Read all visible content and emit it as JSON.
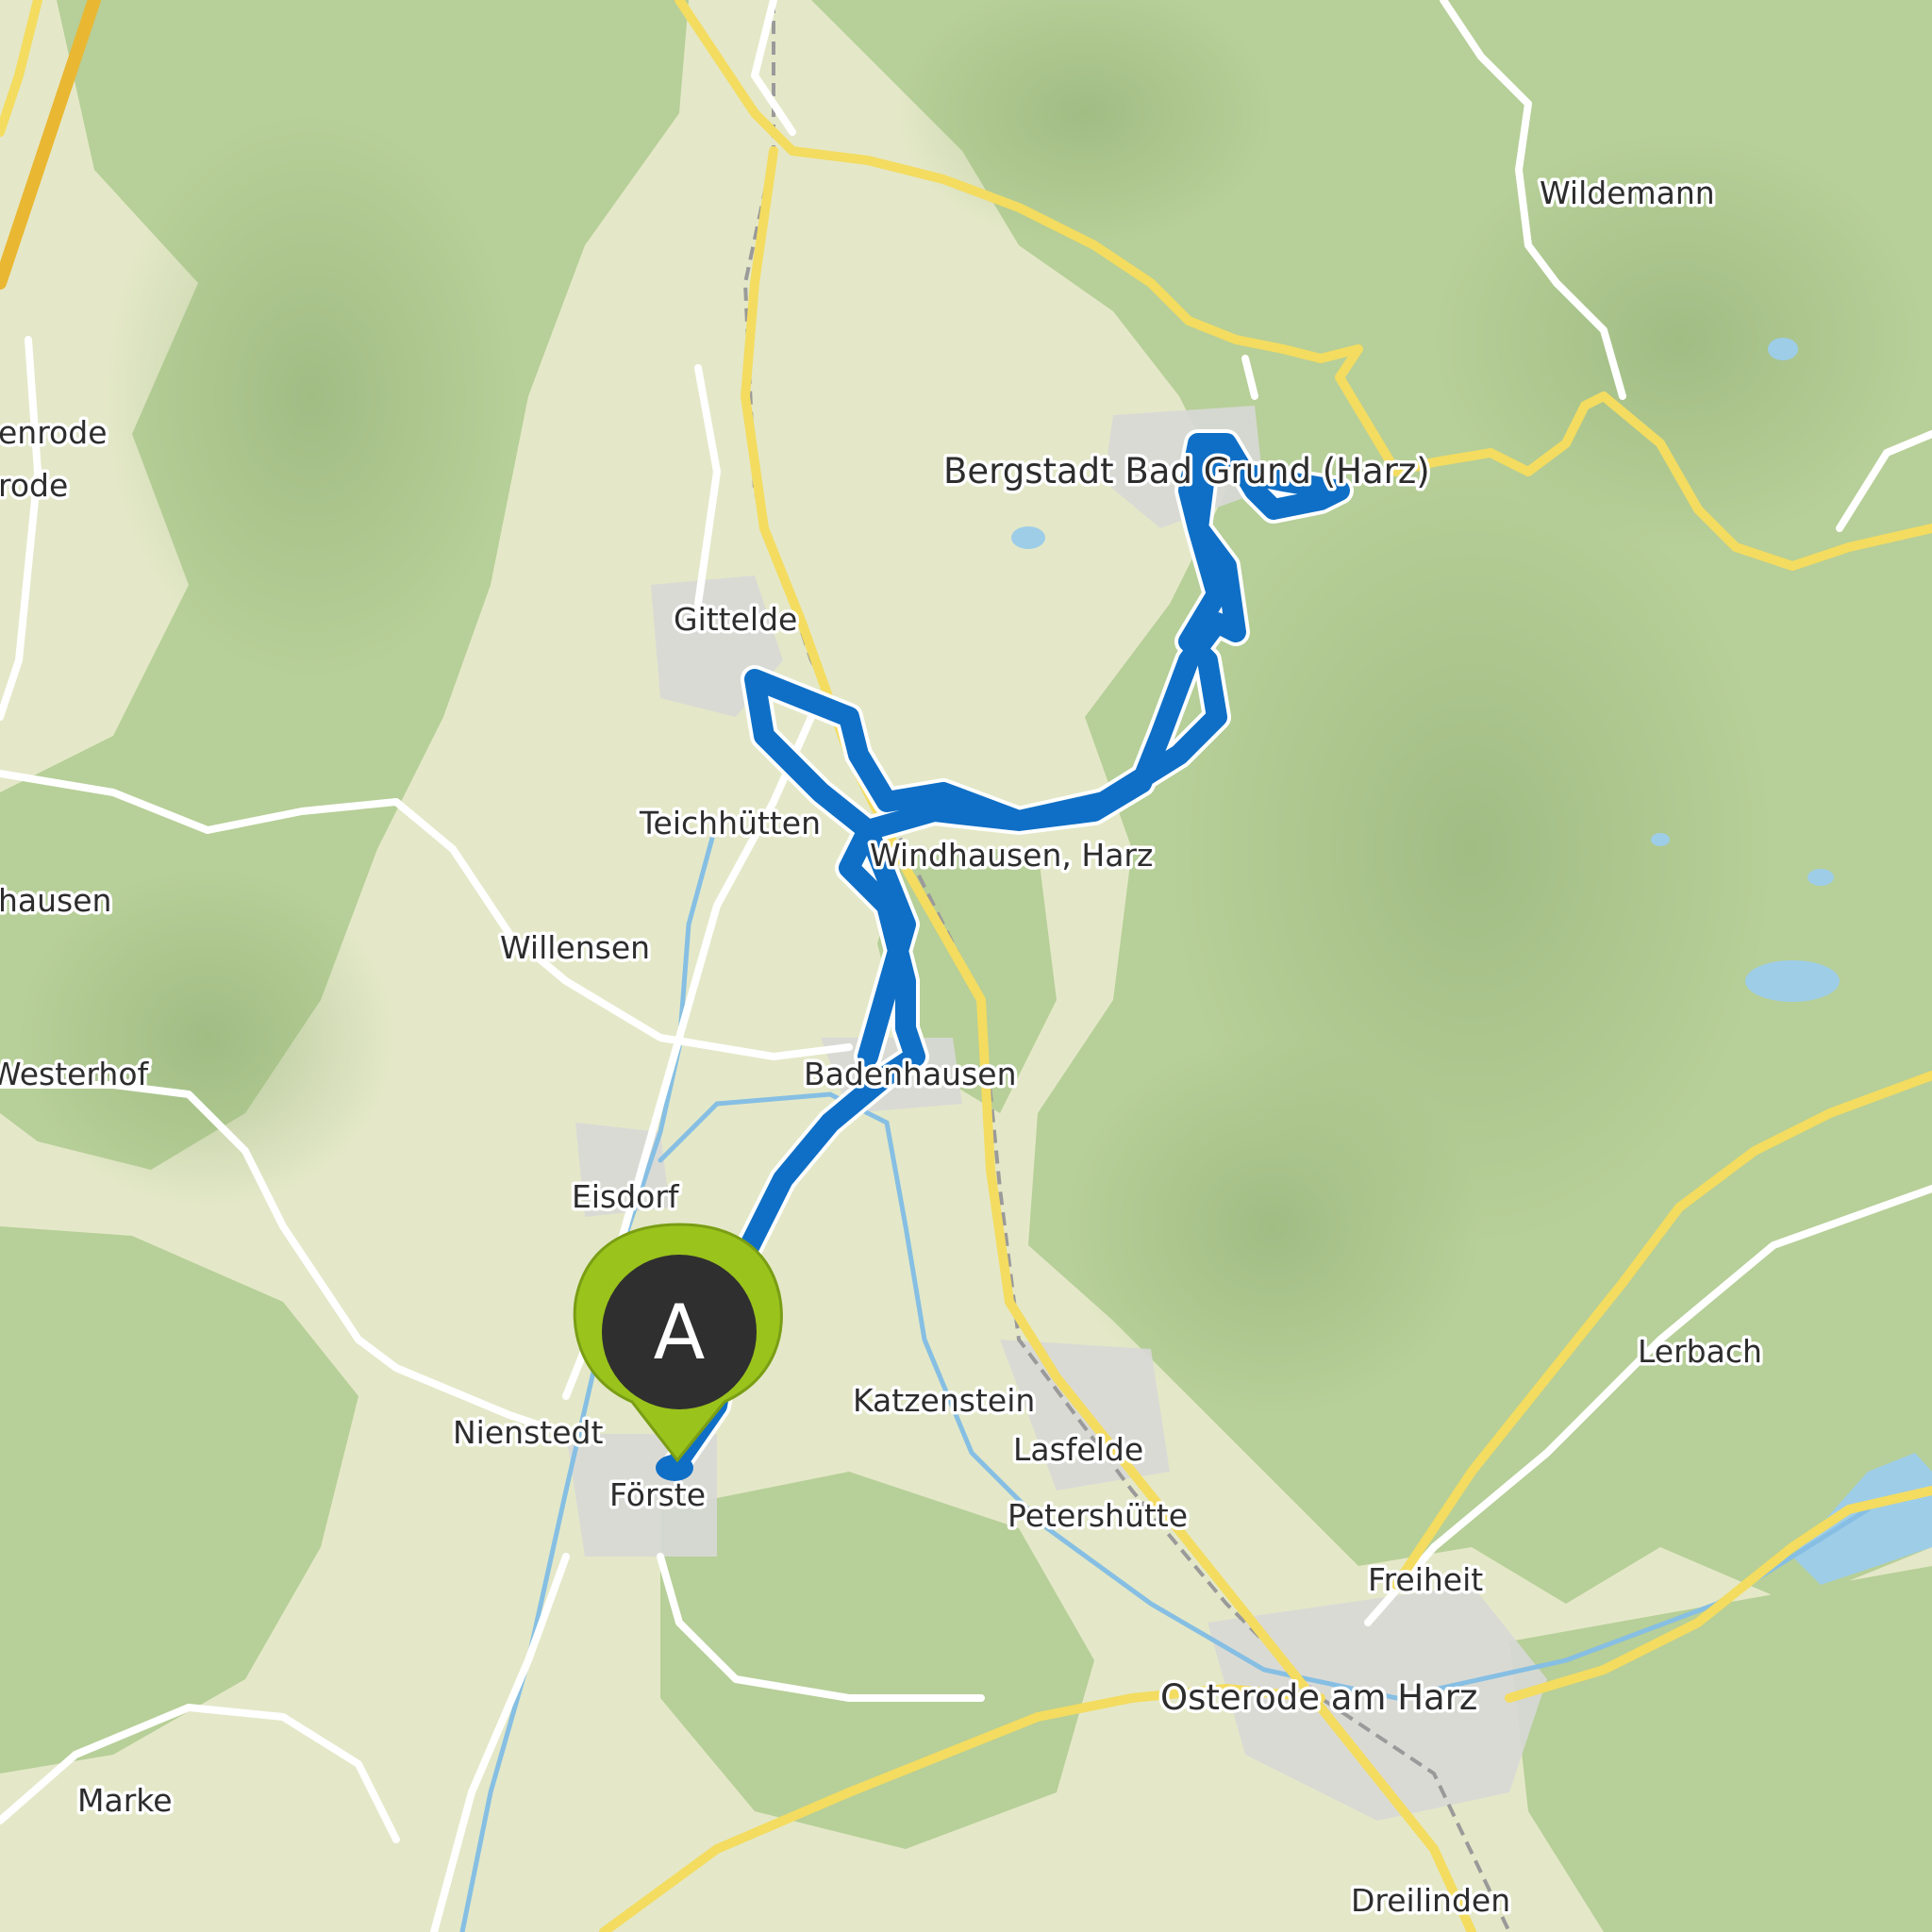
{
  "map": {
    "style": "topographic terrain map with hillshade",
    "colors": {
      "lowland": "#e4e8c8",
      "forest": "#b7cf98",
      "forest_dark": "#9fbd84",
      "settlement": "#d8d8d6",
      "major_road": "#f3dc60",
      "minor_road": "#ffffff",
      "rail": "#9a9a9a",
      "river": "#86bfe3",
      "water": "#9ecde8",
      "route": "#0f6fc6"
    },
    "places": [
      {
        "id": "wildemann",
        "name": "Wildemann"
      },
      {
        "id": "enrode",
        "name": "enrode"
      },
      {
        "id": "rode",
        "name": "rode"
      },
      {
        "id": "bergstadt",
        "name": "Bergstadt Bad Grund (Harz)"
      },
      {
        "id": "gittelde",
        "name": "Gittelde"
      },
      {
        "id": "teichhuetten",
        "name": "Teichhütten"
      },
      {
        "id": "windhausen",
        "name": "Windhausen, Harz"
      },
      {
        "id": "hausen",
        "name": "hausen"
      },
      {
        "id": "willensen",
        "name": "Willensen"
      },
      {
        "id": "westerhof",
        "name": "Westerhof"
      },
      {
        "id": "badenhausen",
        "name": "Badenhausen"
      },
      {
        "id": "eisdorf",
        "name": "Eisdorf"
      },
      {
        "id": "lerbach",
        "name": "Lerbach"
      },
      {
        "id": "katzenstein",
        "name": "Katzenstein"
      },
      {
        "id": "nienstedt",
        "name": "Nienstedt"
      },
      {
        "id": "lasfelde",
        "name": "Lasfelde"
      },
      {
        "id": "foerste",
        "name": "Förste"
      },
      {
        "id": "petershuette",
        "name": "Petershütte"
      },
      {
        "id": "freiheit",
        "name": "Freiheit"
      },
      {
        "id": "osterode",
        "name": "Osterode am Harz"
      },
      {
        "id": "marke",
        "name": "Marke"
      },
      {
        "id": "dreilinden",
        "name": "Dreilinden"
      }
    ],
    "start_marker": {
      "label": "A",
      "pin_color": "#9ac31c",
      "disc_color": "#2f2f2f"
    }
  }
}
